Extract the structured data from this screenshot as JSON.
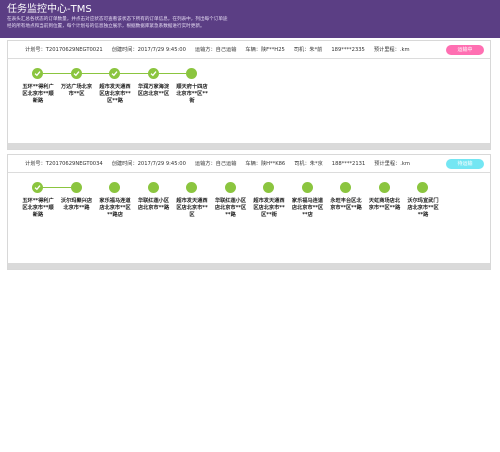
{
  "header": {
    "title": "任务监控中心-TMS",
    "desc_line1": "在表头汇总各状态的订单数量，并点击对应状态可查看该状态下所有的订单信息，在列表中，列出每个订单途",
    "desc_line2": "经的所有地点和当前到位置，每个计划号的信息独立展示，根据数据库紧急系数据进行实时更新。"
  },
  "cards": [
    {
      "plan_no": "计划号：T20170629NEGT0021",
      "created": "创建时间：2017/7/29 9:45:00",
      "carrier": "运输方：自己运输",
      "vehicle": "车辆：陕F**H25",
      "driver": "司机：朱*前",
      "phone": "189****2335",
      "mileage": "预计里程：.km",
      "status": "运输中",
      "status_color": "#ff6fb2",
      "stops": [
        {
          "label": "五环**得利广区北京市**顺新路",
          "done": true
        },
        {
          "label": "万达广场北京市**区",
          "done": true
        },
        {
          "label": "超市发天通西区店北京市**区**路",
          "done": true
        },
        {
          "label": "华润万家海淀区店北京**区",
          "done": true
        },
        {
          "label": "顺天府十四店北京市**区**街",
          "done": false
        }
      ]
    },
    {
      "plan_no": "计划号：T20170629NEGT0034",
      "created": "创建时间：2017/7/29 9:45:00",
      "carrier": "运输方：自己运输",
      "vehicle": "车辆：陕H**K86",
      "driver": "司机：朱*京",
      "phone": "188****2131",
      "mileage": "预计里程：.km",
      "status": "待运输",
      "status_color": "#74e6f3",
      "stops": [
        {
          "label": "五环**得利广区北京市**顺新路",
          "done": true
        },
        {
          "label": "沃尔玛聚兴店北京市**路",
          "done": false
        },
        {
          "label": "家乐福马连道店北京市**区**路店",
          "done": false
        },
        {
          "label": "华联红莲小区店北京市**路",
          "done": false
        },
        {
          "label": "超市发天通西区店北京市**区",
          "done": false
        },
        {
          "label": "华联红莲小区店北京市**区**路",
          "done": false
        },
        {
          "label": "超市发天通西区店北京市**区**街",
          "done": false
        },
        {
          "label": "家乐福马连道店北京市**区**店",
          "done": false
        },
        {
          "label": "永旺丰台区北京市**区**路",
          "done": false
        },
        {
          "label": "天虹商场店北京市**区**路",
          "done": false
        },
        {
          "label": "沃尔玛宣武门店北京市**区**路",
          "done": false
        }
      ]
    }
  ]
}
